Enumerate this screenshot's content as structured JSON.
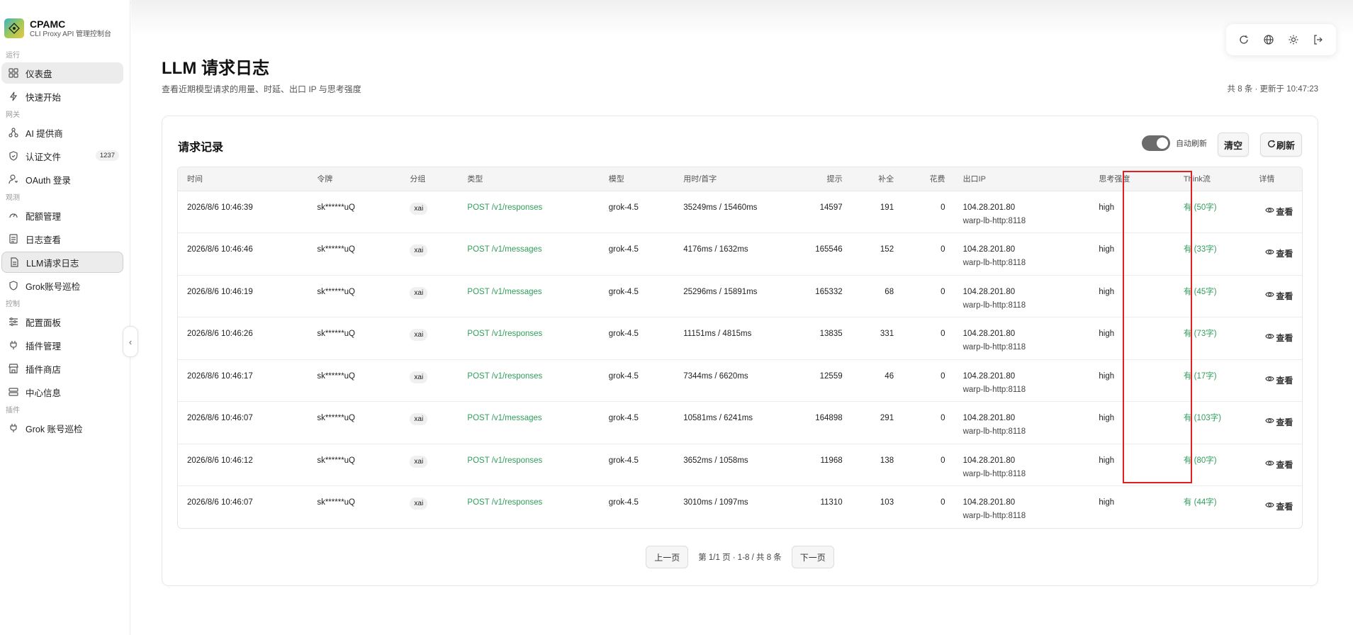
{
  "brand": {
    "title": "CPAMC",
    "subtitle": "CLI Proxy API 管理控制台"
  },
  "sidebar": {
    "sections": {
      "run": "运行",
      "gateway": "网关",
      "observe": "观测",
      "control": "控制",
      "plugins": "插件"
    },
    "items": [
      {
        "label": "仪表盘",
        "icon": "dashboard-icon"
      },
      {
        "label": "快速开始",
        "icon": "bolt-icon"
      },
      {
        "label": "AI 提供商",
        "icon": "network-icon"
      },
      {
        "label": "认证文件",
        "icon": "shield-check-icon",
        "badge": "1237"
      },
      {
        "label": "OAuth 登录",
        "icon": "user-key-icon"
      },
      {
        "label": "配额管理",
        "icon": "gauge-icon"
      },
      {
        "label": "日志查看",
        "icon": "file-lines-icon"
      },
      {
        "label": "LLM请求日志",
        "icon": "file-text-icon"
      },
      {
        "label": "Grok账号巡检",
        "icon": "shield-icon"
      },
      {
        "label": "配置面板",
        "icon": "sliders-icon"
      },
      {
        "label": "插件管理",
        "icon": "plug-icon"
      },
      {
        "label": "插件商店",
        "icon": "store-icon"
      },
      {
        "label": "中心信息",
        "icon": "server-icon"
      },
      {
        "label": "Grok 账号巡检",
        "icon": "plug-icon"
      }
    ]
  },
  "header": {
    "title": "LLM 请求日志",
    "subtitle": "查看近期模型请求的用量、时延、出口 IP 与思考强度",
    "meta": "共 8 条 · 更新于 10:47:23"
  },
  "card": {
    "title": "请求记录",
    "auto_refresh_label": "自动刷新",
    "auto_refresh_on": true,
    "clear_label": "清空",
    "refresh_label": "刷新"
  },
  "table": {
    "columns": [
      "时间",
      "令牌",
      "分组",
      "类型",
      "模型",
      "用时/首字",
      "提示",
      "补全",
      "花费",
      "出口IP",
      "思考强度",
      "Think流",
      "详情"
    ],
    "view_label": "查看",
    "rows": [
      {
        "time": "2026/8/6 10:46:39",
        "token": "sk******uQ",
        "group": "xai",
        "type": "POST /v1/responses",
        "model": "grok-4.5",
        "latency": "35249ms / 15460ms",
        "prompt": "14597",
        "completion": "191",
        "cost": "0",
        "ip": "104.28.201.80",
        "ip_host": "warp-lb-http:8118",
        "effort": "high",
        "think": "有 (50字)"
      },
      {
        "time": "2026/8/6 10:46:46",
        "token": "sk******uQ",
        "group": "xai",
        "type": "POST /v1/messages",
        "model": "grok-4.5",
        "latency": "4176ms / 1632ms",
        "prompt": "165546",
        "completion": "152",
        "cost": "0",
        "ip": "104.28.201.80",
        "ip_host": "warp-lb-http:8118",
        "effort": "high",
        "think": "有 (33字)"
      },
      {
        "time": "2026/8/6 10:46:19",
        "token": "sk******uQ",
        "group": "xai",
        "type": "POST /v1/messages",
        "model": "grok-4.5",
        "latency": "25296ms / 15891ms",
        "prompt": "165332",
        "completion": "68",
        "cost": "0",
        "ip": "104.28.201.80",
        "ip_host": "warp-lb-http:8118",
        "effort": "high",
        "think": "有 (45字)"
      },
      {
        "time": "2026/8/6 10:46:26",
        "token": "sk******uQ",
        "group": "xai",
        "type": "POST /v1/responses",
        "model": "grok-4.5",
        "latency": "11151ms / 4815ms",
        "prompt": "13835",
        "completion": "331",
        "cost": "0",
        "ip": "104.28.201.80",
        "ip_host": "warp-lb-http:8118",
        "effort": "high",
        "think": "有 (73字)"
      },
      {
        "time": "2026/8/6 10:46:17",
        "token": "sk******uQ",
        "group": "xai",
        "type": "POST /v1/responses",
        "model": "grok-4.5",
        "latency": "7344ms / 6620ms",
        "prompt": "12559",
        "completion": "46",
        "cost": "0",
        "ip": "104.28.201.80",
        "ip_host": "warp-lb-http:8118",
        "effort": "high",
        "think": "有 (17字)"
      },
      {
        "time": "2026/8/6 10:46:07",
        "token": "sk******uQ",
        "group": "xai",
        "type": "POST /v1/messages",
        "model": "grok-4.5",
        "latency": "10581ms / 6241ms",
        "prompt": "164898",
        "completion": "291",
        "cost": "0",
        "ip": "104.28.201.80",
        "ip_host": "warp-lb-http:8118",
        "effort": "high",
        "think": "有 (103字)"
      },
      {
        "time": "2026/8/6 10:46:12",
        "token": "sk******uQ",
        "group": "xai",
        "type": "POST /v1/responses",
        "model": "grok-4.5",
        "latency": "3652ms / 1058ms",
        "prompt": "11968",
        "completion": "138",
        "cost": "0",
        "ip": "104.28.201.80",
        "ip_host": "warp-lb-http:8118",
        "effort": "high",
        "think": "有 (80字)"
      },
      {
        "time": "2026/8/6 10:46:07",
        "token": "sk******uQ",
        "group": "xai",
        "type": "POST /v1/responses",
        "model": "grok-4.5",
        "latency": "3010ms / 1097ms",
        "prompt": "11310",
        "completion": "103",
        "cost": "0",
        "ip": "104.28.201.80",
        "ip_host": "warp-lb-http:8118",
        "effort": "high",
        "think": "有 (44字)"
      }
    ]
  },
  "pager": {
    "prev": "上一页",
    "info": "第 1/1 页 · 1-8 / 共 8 条",
    "next": "下一页"
  },
  "colors": {
    "accent_green": "#2f9e5a",
    "highlight_red": "#e02020",
    "toggle_on": "#6b6b6b"
  }
}
